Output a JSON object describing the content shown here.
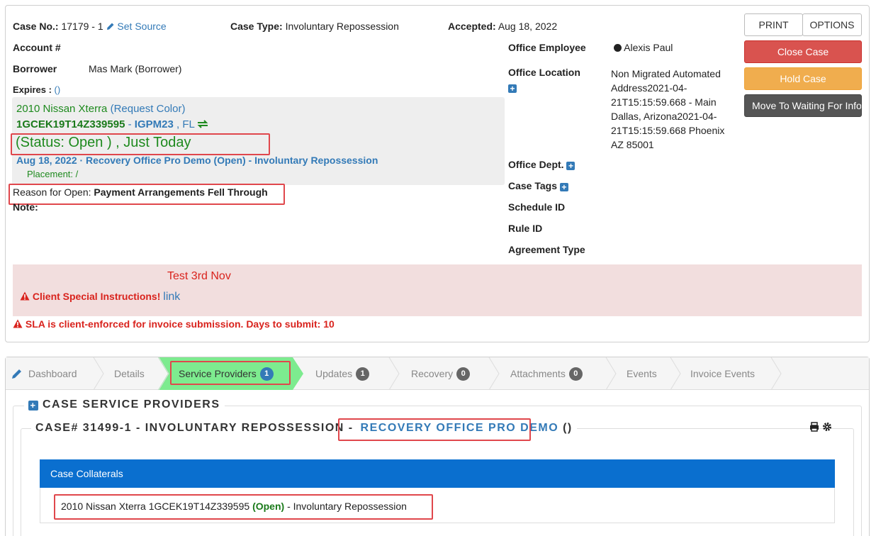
{
  "case": {
    "case_no_label": "Case No.:",
    "case_no_value": "17179 - 1",
    "set_source": "Set Source",
    "case_type_label": "Case Type:",
    "case_type_value": "Involuntary Repossession",
    "accepted_label": "Accepted:",
    "accepted_value": "Aug 18, 2022",
    "account_label": "Account #",
    "borrower_label": "Borrower",
    "borrower_value": "Mas Mark (Borrower)",
    "expires_label": "Expires :",
    "expires_value": "()"
  },
  "vehicle": {
    "name": "2010 Nissan Xterra",
    "request_color": "(Request Color)",
    "vin": "1GCEK19T14Z339595",
    "dash": "-",
    "plate": "IGPM23",
    "state": ", FL",
    "status": "(Status: Open ) , Just Today",
    "assignment": "Aug 18, 2022 · Recovery Office Pro Demo (Open) - Involuntary Repossession",
    "placement": "Placement: /"
  },
  "reason": {
    "label": "Reason for Open:",
    "value": "Payment Arrangements Fell Through"
  },
  "note_label": "Note:",
  "office": {
    "employee_label": "Office Employee",
    "employee_value": "Alexis Paul",
    "location_label": "Office Location",
    "location_lines": [
      "Non Migrated Automated",
      "Address2021-04-",
      "21T15:15:59.668 - Main",
      "Dallas, Arizona2021-04-",
      "21T15:15:59.668 Phoenix",
      "AZ 85001"
    ],
    "dept_label": "Office Dept.",
    "tags_label": "Case Tags",
    "schedule_label": "Schedule ID",
    "rule_label": "Rule ID",
    "agreement_label": "Agreement Type"
  },
  "buttons": {
    "print": "PRINT",
    "options": "OPTIONS",
    "close_case": "Close Case",
    "hold_case": "Hold Case",
    "move_waiting": "Move To Waiting For Info"
  },
  "alerts": {
    "test_note": "Test 3rd Nov",
    "special_instructions": "Client Special Instructions!",
    "link": "link",
    "sla": "SLA is client-enforced for invoice submission. Days to submit: 10"
  },
  "tabs": [
    {
      "label": "Dashboard",
      "badge": ""
    },
    {
      "label": "Details",
      "badge": ""
    },
    {
      "label": "Service Providers",
      "badge": "1"
    },
    {
      "label": "Updates",
      "badge": "1"
    },
    {
      "label": "Recovery",
      "badge": "0"
    },
    {
      "label": "Attachments",
      "badge": "0"
    },
    {
      "label": "Events",
      "badge": ""
    },
    {
      "label": "Invoice Events",
      "badge": ""
    }
  ],
  "service_providers": {
    "section_title": "CASE SERVICE PROVIDERS",
    "case_heading": "CASE# 31499-1 - INVOLUNTARY REPOSSESSION -",
    "provider_name": "RECOVERY OFFICE PRO DEMO",
    "provider_suffix": "()",
    "collaterals_title": "Case Collaterals",
    "collateral_prefix": "2010 Nissan Xterra 1GCEK19T14Z339595",
    "collateral_status": "(Open)",
    "collateral_suffix": "- Involuntary Repossession"
  }
}
